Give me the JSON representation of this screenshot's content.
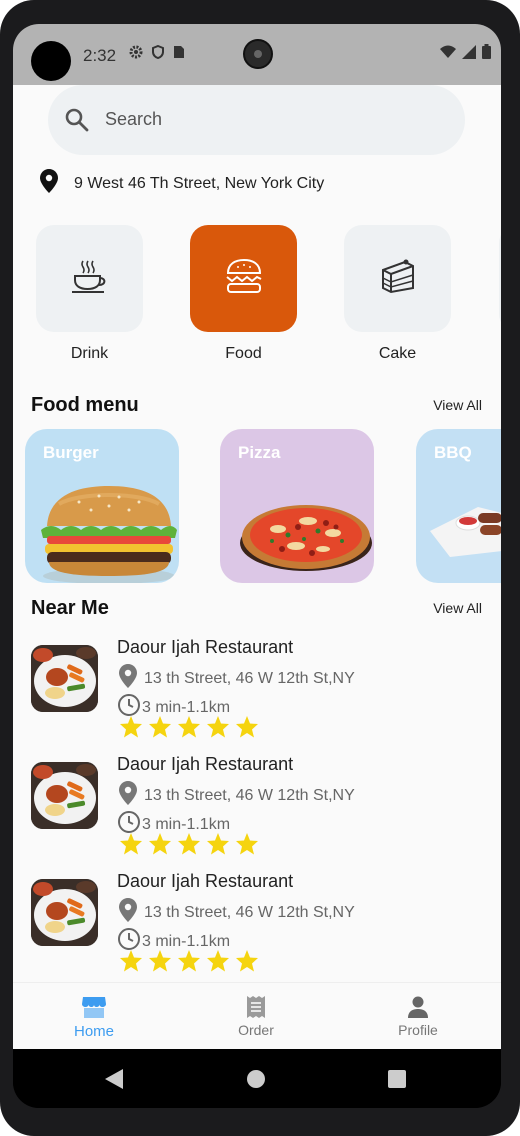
{
  "status_bar": {
    "time": "2:32"
  },
  "search": {
    "placeholder": "Search"
  },
  "location": {
    "address": "9 West 46 Th Street, New York City"
  },
  "categories": [
    {
      "label": "Drink",
      "icon": "coffee-cup-icon",
      "active": false
    },
    {
      "label": "Food",
      "icon": "burger-icon",
      "active": true
    },
    {
      "label": "Cake",
      "icon": "cake-icon",
      "active": false
    }
  ],
  "food_menu": {
    "title": "Food menu",
    "view_all": "View All",
    "items": [
      {
        "label": "Burger",
        "bg": "#bfe0f4"
      },
      {
        "label": "Pizza",
        "bg": "#dcc7e6"
      },
      {
        "label": "BBQ",
        "bg": "#c3e0f4"
      }
    ]
  },
  "near_me": {
    "title": "Near Me",
    "view_all": "View All",
    "items": [
      {
        "name": "Daour Ijah Restaurant",
        "address": "13 th Street, 46 W 12th St,NY",
        "eta": "3 min-1.1km",
        "rating": 5
      },
      {
        "name": "Daour Ijah Restaurant",
        "address": "13 th Street, 46 W 12th St,NY",
        "eta": "3 min-1.1km",
        "rating": 5
      },
      {
        "name": "Daour Ijah Restaurant",
        "address": "13 th Street, 46 W 12th St,NY",
        "eta": "3 min-1.1km",
        "rating": 5
      }
    ]
  },
  "bottom_nav": [
    {
      "label": "Home",
      "icon": "store-icon",
      "active": true
    },
    {
      "label": "Order",
      "icon": "receipt-icon",
      "active": false
    },
    {
      "label": "Profile",
      "icon": "person-icon",
      "active": false
    }
  ],
  "colors": {
    "accent": "#d9580b",
    "active_nav": "#3d9cf0",
    "star": "#f5d40f"
  }
}
